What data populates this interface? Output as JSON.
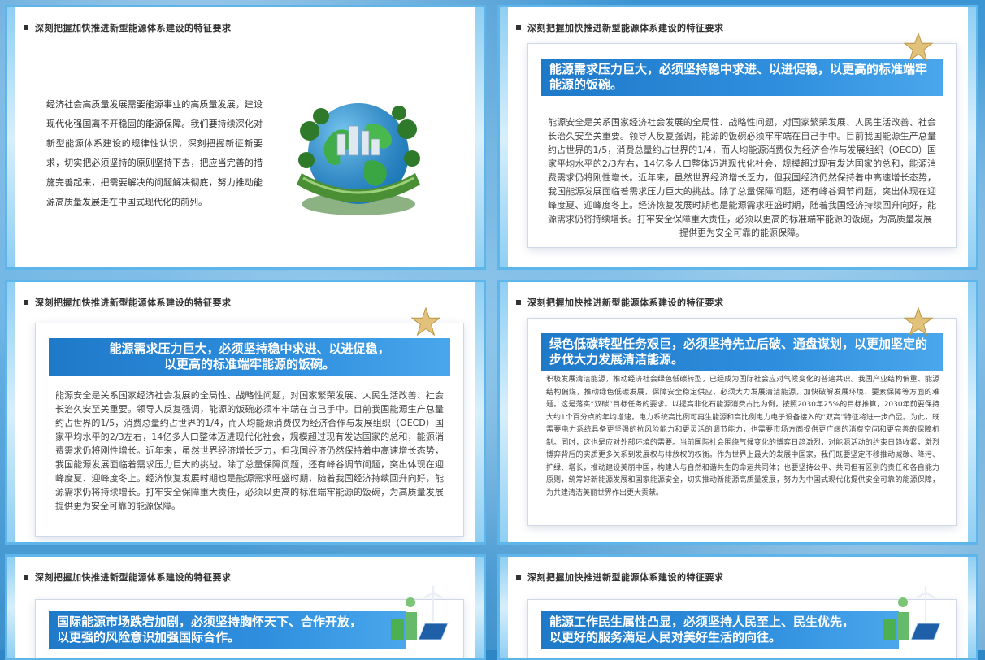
{
  "header_title": "深刻把握加快推进新型能源体系建设的特征要求",
  "slide1": {
    "body": "经济社会高质量发展需要能源事业的高质量发展，建设现代化强国离不开稳固的能源保障。我们要持续深化对新型能源体系建设的规律性认识，深刻把握新征新要求，切实把必须坚持的原则坚持下去，把应当完善的措施完善起来，把需要解决的问题解决彻底，努力推动能源高质量发展走在中国式现代化的前列。"
  },
  "slide2": {
    "banner": "能源需求压力巨大，必须坚持稳中求进、以进促稳，以更高的标准端牢能源的饭碗。",
    "body": "能源安全是关系国家经济社会发展的全局性、战略性问题，对国家繁荣发展、人民生活改善、社会长治久安至关重要。领导人反复强调，能源的饭碗必须牢牢端在自己手中。目前我国能源生产总量约占世界的1/5，消费总量约占世界的1/4，而人均能源消费仅为经济合作与发展组织（OECD）国家平均水平的2/3左右，14亿多人口整体迈进现代化社会，规模超过现有发达国家的总和，能源消费需求仍将刚性增长。近年来，虽然世界经济增长乏力，但我国经济仍然保持着中高速增长态势，我国能源发展面临着需求压力巨大的挑战。除了总量保障问题，还有峰谷调节问题，突出体现在迎峰度夏、迎峰度冬上。经济恢复发展时期也是能源需求旺盛时期，随着我国经济持续回升向好，能源需求仍将持续增长。打牢安全保障重大责任，必须以更高的标准端牢能源的饭碗，为高质量发展",
    "body_last": "提供更为安全可靠的能源保障。"
  },
  "slide3": {
    "banner_line1": "能源需求压力巨大，必须坚持稳中求进、以进促稳，",
    "banner_line2": "以更高的标准端牢能源的饭碗。",
    "body": "能源安全是关系国家经济社会发展的全局性、战略性问题，对国家繁荣发展、人民生活改善、社会长治久安至关重要。领导人反复强调，能源的饭碗必须牢牢端在自己手中。目前我国能源生产总量约占世界的1/5，消费总量约占世界的1/4，而人均能源消费仅为经济合作与发展组织（OECD）国家平均水平的2/3左右，14亿多人口整体迈进现代化社会，规模超过现有发达国家的总和，能源消费需求仍将刚性增长。近年来，虽然世界经济增长乏力，但我国经济仍然保持着中高速增长态势，我国能源发展面临着需求压力巨大的挑战。除了总量保障问题，还有峰谷调节问题，突出体现在迎峰度夏、迎峰度冬上。经济恢复发展时期也是能源需求旺盛时期，随着我国经济持续回升向好，能源需求仍将持续增长。打牢安全保障重大责任，必须以更高的标准端牢能源的饭碗，为高质量发展提供更为安全可靠的能源保障。"
  },
  "slide4": {
    "banner": "绿色低碳转型任务艰巨，必须坚持先立后破、通盘谋划，以更加坚定的步伐大力发展清洁能源。",
    "body": "积极发展清洁能源，推动经济社会绿色低碳转型，已经成为国际社会应对气候变化的普遍共识。我国产业结构偏重、能源结构偏煤，推动绿色低碳发展，保障安全稳定供应，必须大力发展清洁能源，加快破解发展环境、要素保障等方面的难题。这是落实“双碳”目标任务的要求。以提高非化石能源消费占比为例，按照2030年25%的目标推算，2030年前要保持大约1个百分点的年均增速，电力系统高比例可再生能源和高比例电力电子设备接入的“双高”特征将进一步凸显。为此，既需要电力系统具备更坚强的抗风险能力和更灵活的调节能力，也需要市场方面提供更广阔的消费空间和更完善的保障机制。同时，这也是应对外部环境的需要。当前国际社会围绕气候变化的博弈日趋激烈，对能源活动的约束日趋收紧，激烈博弈背后的实质更多关系到发展权与排放权的权衡。作为世界上最大的发展中国家，我们既要坚定不移推动减碳、降污、扩绿、增长，推动建设美丽中国，构建人与自然和谐共生的命运共同体；也要坚持公平、共同但有区别的责任和各自能力原则，统筹好新能源发展和国家能源安全，切实推动新能源高质量发展，努力为中国式现代化提供安全可靠的能源保障，为共建清洁美丽世界作出更大贡献。"
  },
  "slide5": {
    "banner_line1": "国际能源市场跌宕加剧，必须坚持胸怀天下、合作开放，",
    "banner_line2": "以更强的风险意识加强国际合作。"
  },
  "slide6": {
    "banner_line1": "能源工作民生属性凸显，必须坚持人民至上、民生优先，",
    "banner_line2": "以更好的服务满足人民对美好生活的向往。"
  },
  "icons": {
    "header_marker": "square-bullet-icon",
    "star": "gold-star-icon",
    "globe": "green-earth-globe",
    "eco": "wind-solar-icon"
  },
  "colors": {
    "banner": "#2f8fde",
    "frame": "#5eb5ea",
    "header_text": "#333333"
  }
}
